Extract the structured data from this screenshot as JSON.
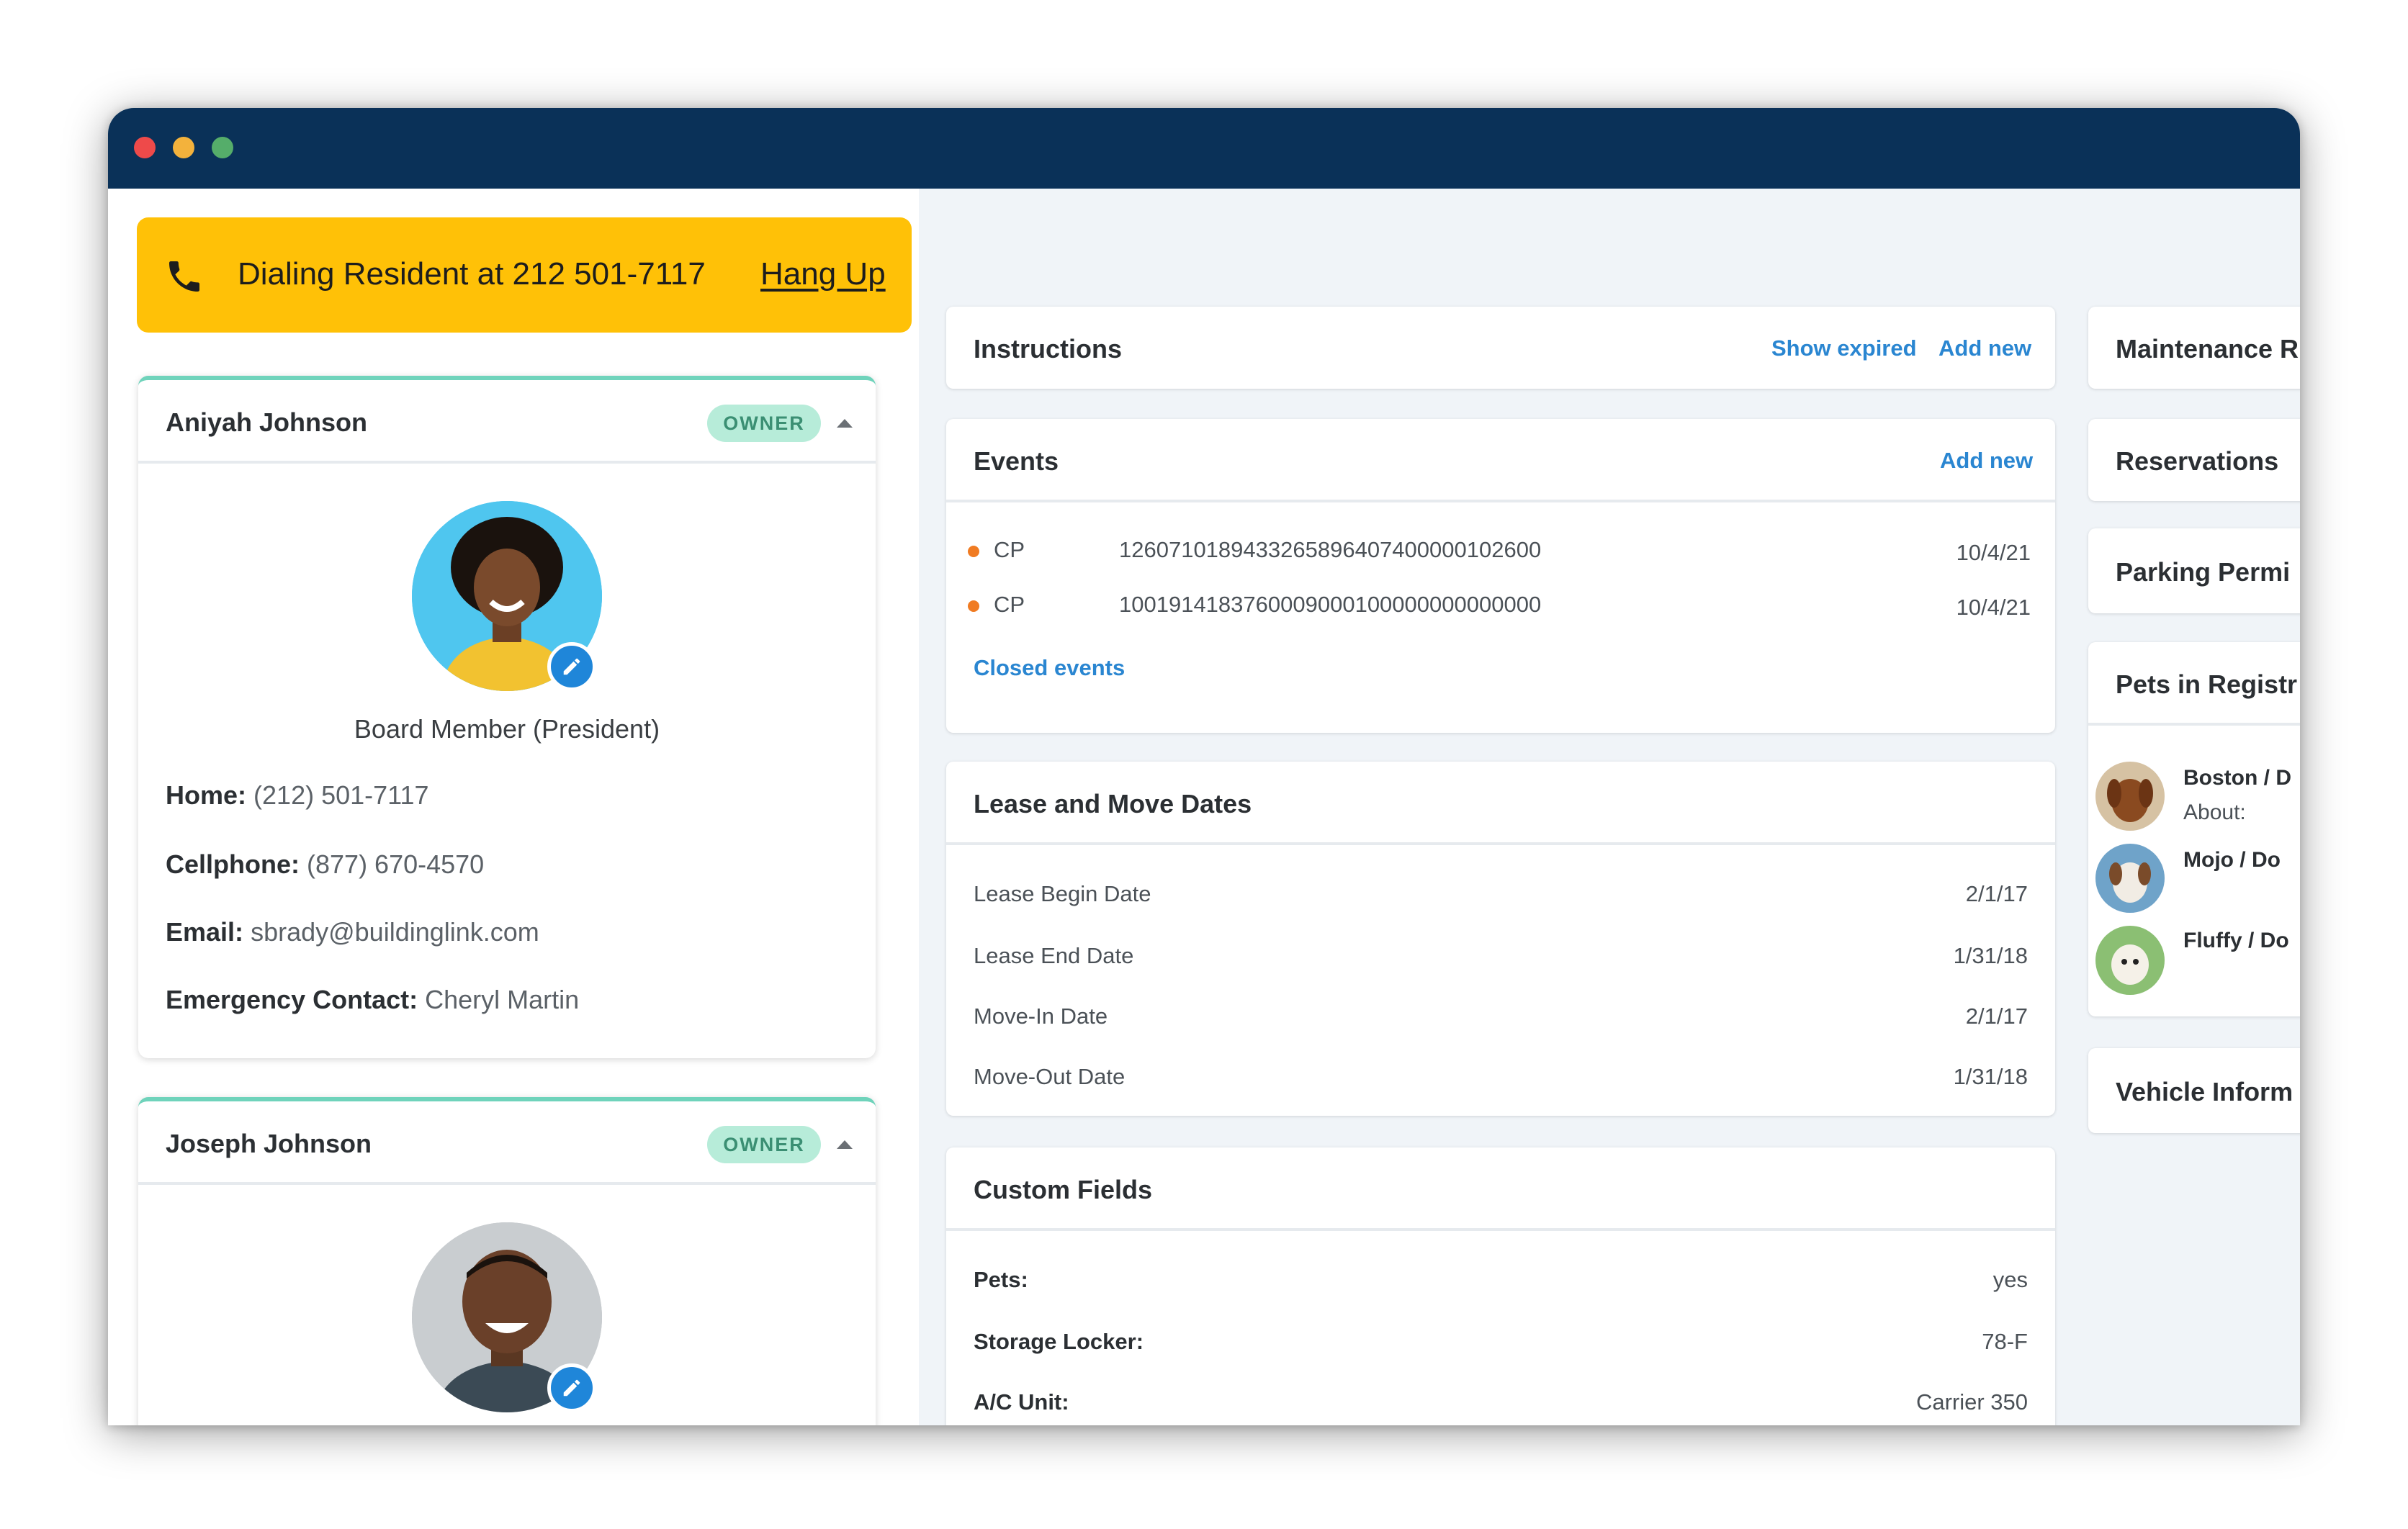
{
  "window": {
    "controls": [
      "close",
      "minimize",
      "maximize"
    ]
  },
  "call_banner": {
    "icon": "phone-icon",
    "text": "Dialing Resident at 212 501-7117",
    "hangup_label": "Hang Up",
    "color": "#ffc107"
  },
  "residents": [
    {
      "name": "Aniyah Johnson",
      "badge": "OWNER",
      "role": "Board Member (President)",
      "home_label": "Home:",
      "home": "(212) 501-7117",
      "cell_label": "Cellphone:",
      "cell": "(877) 670-4570",
      "email_label": "Email:",
      "email": "sbrady@buildinglink.com",
      "emergency_label": "Emergency Contact:",
      "emergency": "Cheryl Martin"
    },
    {
      "name": "Joseph Johnson",
      "badge": "OWNER"
    }
  ],
  "instructions": {
    "title": "Instructions",
    "show_expired": "Show expired",
    "add_new": "Add new"
  },
  "events": {
    "title": "Events",
    "add_new": "Add new",
    "items": [
      {
        "type": "CP",
        "code": "1260710189433265896407400000102600",
        "date": "10/4/21"
      },
      {
        "type": "CP",
        "code": "1001914183760009000100000000000000",
        "date": "10/4/21"
      }
    ],
    "closed_link": "Closed events"
  },
  "lease": {
    "title": "Lease and Move Dates",
    "rows": [
      {
        "label": "Lease Begin Date",
        "value": "2/1/17"
      },
      {
        "label": "Lease End Date",
        "value": "1/31/18"
      },
      {
        "label": "Move-In Date",
        "value": "2/1/17"
      },
      {
        "label": "Move-Out Date",
        "value": "1/31/18"
      }
    ]
  },
  "custom_fields": {
    "title": "Custom Fields",
    "rows": [
      {
        "label": "Pets:",
        "value": "yes"
      },
      {
        "label": "Storage Locker:",
        "value": "78-F"
      },
      {
        "label": "A/C Unit:",
        "value": "Carrier 350"
      }
    ]
  },
  "side_panels": {
    "maintenance": "Maintenance R",
    "reservations": "Reservations",
    "parking": "Parking Permi",
    "pets": "Pets in Registr",
    "vehicle": "Vehicle Inform"
  },
  "pets": [
    {
      "name": "Boston / D",
      "about": "About:"
    },
    {
      "name": "Mojo / Do"
    },
    {
      "name": "Fluffy / Do"
    }
  ],
  "colors": {
    "titlebar": "#0a3158",
    "link": "#2a86d1",
    "owner_badge_bg": "#b7ecd9",
    "event_dot": "#f07b22",
    "card_accent": "#6fd3bb"
  }
}
